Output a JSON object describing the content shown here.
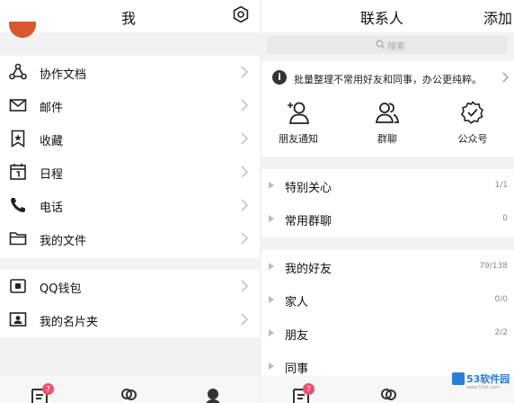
{
  "me_panel": {
    "title": "我",
    "group_main": [
      {
        "label": "协作文档",
        "icon": "collab-doc-icon"
      },
      {
        "label": "邮件",
        "icon": "mail-icon"
      },
      {
        "label": "收藏",
        "icon": "bookmark-icon"
      },
      {
        "label": "日程",
        "icon": "calendar-icon"
      },
      {
        "label": "电话",
        "icon": "phone-icon"
      },
      {
        "label": "我的文件",
        "icon": "folder-icon"
      }
    ],
    "group_wallet": [
      {
        "label": "QQ钱包",
        "icon": "wallet-icon"
      },
      {
        "label": "我的名片夹",
        "icon": "card-holder-icon"
      }
    ],
    "tabbar": {
      "messages_badge": "7"
    }
  },
  "contacts_panel": {
    "title": "联系人",
    "add_label": "添加",
    "search_placeholder": "搜索",
    "notice_text": "批量整理不常用好友和同事，办公更纯粹。",
    "quick_actions": [
      {
        "label": "朋友通知",
        "icon": "friend-notify-icon"
      },
      {
        "label": "群聊",
        "icon": "group-chat-icon"
      },
      {
        "label": "公众号",
        "icon": "official-account-icon"
      }
    ],
    "groups_top": [
      {
        "name": "特别关心",
        "count": "1/1"
      },
      {
        "name": "常用群聊",
        "count": "0"
      }
    ],
    "groups_bottom": [
      {
        "name": "我的好友",
        "count": "79/138"
      },
      {
        "name": "家人",
        "count": "0/0"
      },
      {
        "name": "朋友",
        "count": "2/2"
      },
      {
        "name": "同事",
        "count": ""
      }
    ],
    "tabbar": {
      "messages_badge": "7"
    }
  },
  "watermark": {
    "brand": "53软件园",
    "url": "www.53xt.com"
  },
  "colors": {
    "badge": "#f0506e",
    "avatar": "#d9582f",
    "watermark": "#2a7fd4"
  }
}
